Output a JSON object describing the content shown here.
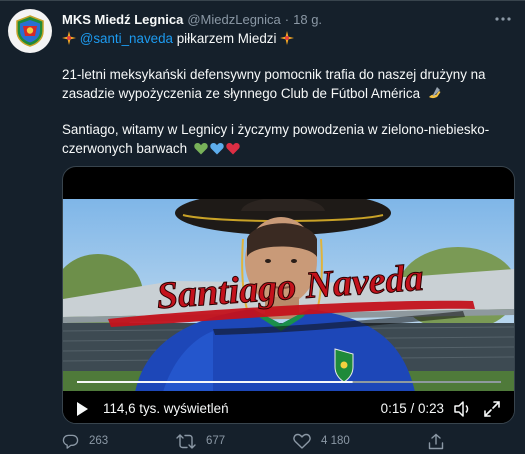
{
  "tweet": {
    "author_name": "MKS Miedź Legnica",
    "author_handle": "@MiedzLegnica",
    "separator": "·",
    "time": "18 g.",
    "mention": "@santi_naveda",
    "line1_suffix": " piłkarzem Miedzi ",
    "body_line2": "21-letni meksykański defensywny pomocnik trafia do naszej drużyny na",
    "body_line3": "zasadzie wypożyczenia ze słynnego Club de Fútbol América",
    "body_line4": "Santiago, witamy w Legnicy i życzymy powodzenia w zielono-niebiesko-",
    "body_line5": "czerwonych barwach"
  },
  "video": {
    "overlay_title": "Santiago Naveda",
    "views": "114,6 tys. wyświetleń",
    "elapsed": "0:15",
    "duration": "0:23",
    "time_separator": "/",
    "progress": 0.65
  },
  "actions": {
    "replies": "263",
    "retweets": "677",
    "likes": "4 180"
  },
  "colors": {
    "background": "#15202b",
    "text": "#f7f9f9",
    "muted": "#8b98a5",
    "link": "#1d9bf0",
    "title_red": "#c4121c"
  },
  "icons": [
    "club-crest-icon",
    "more-icon",
    "sparkle-icon",
    "writing-hand-icon",
    "green-heart-icon",
    "blue-heart-icon",
    "red-heart-icon",
    "play-icon",
    "volume-icon",
    "fullscreen-icon",
    "reply-icon",
    "retweet-icon",
    "like-icon",
    "share-icon"
  ]
}
